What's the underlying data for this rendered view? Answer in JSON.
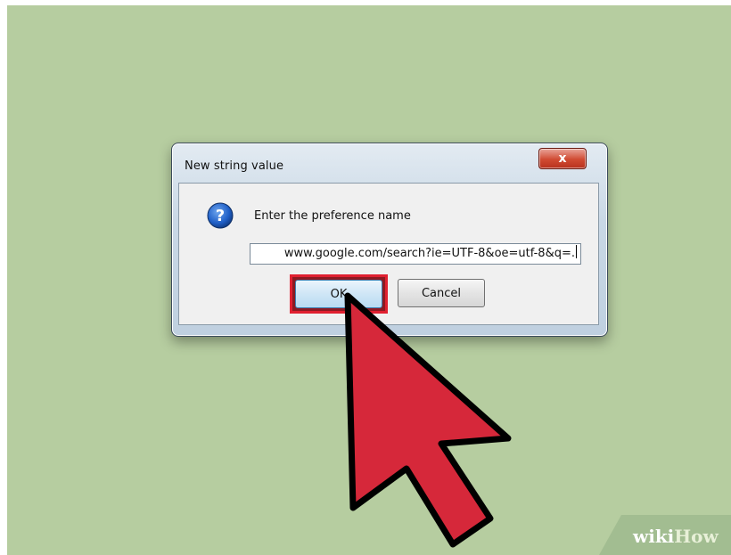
{
  "dialog": {
    "title": "New string value",
    "close_label": "x",
    "prompt": "Enter the preference name",
    "input_value": "www.google.com/search?ie=UTF-8&oe=utf-8&q=.",
    "ok_label": "OK",
    "cancel_label": "Cancel"
  },
  "watermark": {
    "part1": "wiki",
    "part2": "How"
  },
  "colors": {
    "background": "#b6cda0",
    "highlight": "#e02030",
    "cursor": "#d6283a"
  },
  "icons": [
    "question-icon",
    "close-icon",
    "mouse-pointer-icon"
  ]
}
